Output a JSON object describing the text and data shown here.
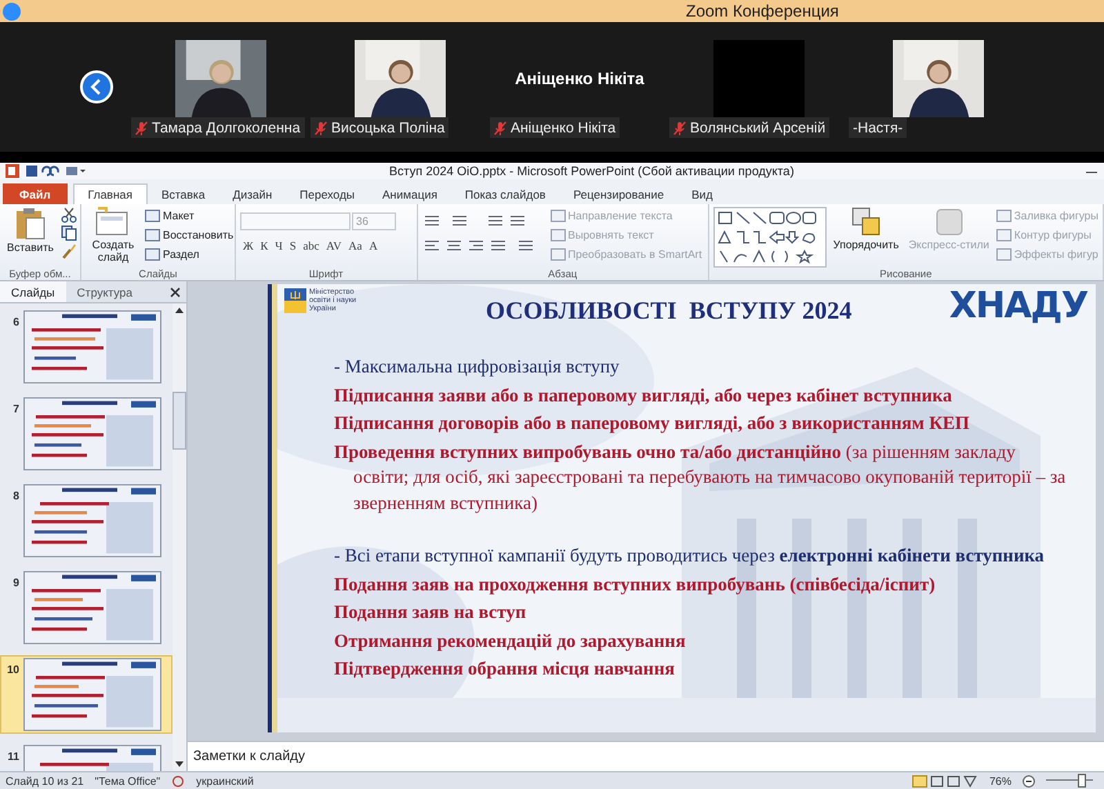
{
  "zoom": {
    "title": "Zoom Конференция",
    "participants": [
      {
        "name": "Тамара Долгоколенна",
        "kind": "camera",
        "muted": true
      },
      {
        "name": "Висоцька Поліна",
        "kind": "camera",
        "muted": true
      },
      {
        "name": "Аніщенко Нікіта",
        "kind": "name",
        "display_name": "Аніщенко Нікіта",
        "muted": true
      },
      {
        "name": "Волянський Арсеній",
        "kind": "off",
        "muted": true
      },
      {
        "name": "-Настя-",
        "kind": "camera",
        "muted": false
      }
    ]
  },
  "powerpoint": {
    "title": "Вступ 2024 ОіО.pptx  -  Microsoft PowerPoint (Сбой активации продукта)",
    "tabs": [
      {
        "label": "Файл",
        "kind": "file",
        "selected": false
      },
      {
        "label": "Главная",
        "kind": "tab",
        "selected": true
      },
      {
        "label": "Вставка",
        "kind": "tab",
        "selected": false
      },
      {
        "label": "Дизайн",
        "kind": "tab",
        "selected": false
      },
      {
        "label": "Переходы",
        "kind": "tab",
        "selected": false
      },
      {
        "label": "Анимация",
        "kind": "tab",
        "selected": false
      },
      {
        "label": "Показ слайдов",
        "kind": "tab",
        "selected": false
      },
      {
        "label": "Рецензирование",
        "kind": "tab",
        "selected": false
      },
      {
        "label": "Вид",
        "kind": "tab",
        "selected": false
      }
    ],
    "ribbon": [
      {
        "kind": "clipboard",
        "label": "Буфер обм...",
        "big": "Вставить"
      },
      {
        "kind": "slides",
        "label": "Слайды",
        "big": "Создать слайд",
        "items": [
          {
            "label": "Макет",
            "disabled": false
          },
          {
            "label": "Восстановить",
            "disabled": false
          },
          {
            "label": "Раздел",
            "disabled": false
          }
        ]
      },
      {
        "kind": "font",
        "label": "Шрифт",
        "size": "36",
        "buttons": [
          "Ж",
          "К",
          "Ч",
          "S",
          "abc",
          "AV",
          "Aa",
          "A"
        ]
      },
      {
        "kind": "paragraph",
        "label": "Абзац",
        "items": [
          {
            "label": "Направление текста",
            "disabled": true
          },
          {
            "label": "Выровнять текст",
            "disabled": true
          },
          {
            "label": "Преобразовать в SmartArt",
            "disabled": true
          }
        ]
      },
      {
        "kind": "drawing",
        "label": "Рисование",
        "arrange": "Упорядочить",
        "styles": "Экспресс-стили",
        "items": [
          {
            "label": "Заливка фигуры",
            "disabled": true
          },
          {
            "label": "Контур фигуры",
            "disabled": true
          },
          {
            "label": "Эффекты фигур",
            "disabled": true
          }
        ]
      }
    ],
    "panel_tabs": [
      {
        "label": "Слайды",
        "selected": true
      },
      {
        "label": "Структура",
        "selected": false
      }
    ],
    "thumbnails": [
      {
        "number": "6",
        "selected": false
      },
      {
        "number": "7",
        "selected": false
      },
      {
        "number": "8",
        "selected": false
      },
      {
        "number": "9",
        "selected": false
      },
      {
        "number": "10",
        "selected": true
      },
      {
        "number": "11",
        "selected": false
      }
    ],
    "slide": {
      "ministry": "Міністерство освіти і науки України",
      "logo": "ХНАДУ",
      "title": "ОСОБЛИВОСТІ  ВСТУПУ 2024",
      "lines": [
        {
          "kind": "intro",
          "text": "- Максимальна цифровізація вступу"
        },
        {
          "kind": "item",
          "text": "**Підписання заяви або в паперовому вигляді, або через кабінет вступника**"
        },
        {
          "kind": "item",
          "text": "**Підписання договорів або в паперовому вигляді, або з використанням КЕП**"
        },
        {
          "kind": "item",
          "text": "**Проведення вступних випробувань очно та/або дистанційно** (за рішенням закладу освіти; для осіб, які зареєстровані та перебувають на тимчасово окупованій території – за зверненням вступника)"
        },
        {
          "kind": "intro",
          "text": "- Всі етапи вступної кампанії будуть проводитись через **електронні кабінети вступника**"
        },
        {
          "kind": "item",
          "text": "**Подання заяв на проходження вступних випробувань (співбесіда/іспит)**"
        },
        {
          "kind": "item",
          "text": "**Подання заяв на вступ**"
        },
        {
          "kind": "item",
          "text": "**Отримання рекомендацій до зарахування**"
        },
        {
          "kind": "item",
          "text": "**Підтвердження обрання місця навчання**"
        }
      ]
    },
    "notes": {
      "placeholder": "Заметки к слайду"
    },
    "status_bar": {
      "slide": "Слайд 10 из 21",
      "theme": "\"Тема Office\"",
      "language": "украинский",
      "zoom": "76%",
      "zoom_slider": {
        "level": 0.75
      }
    }
  }
}
